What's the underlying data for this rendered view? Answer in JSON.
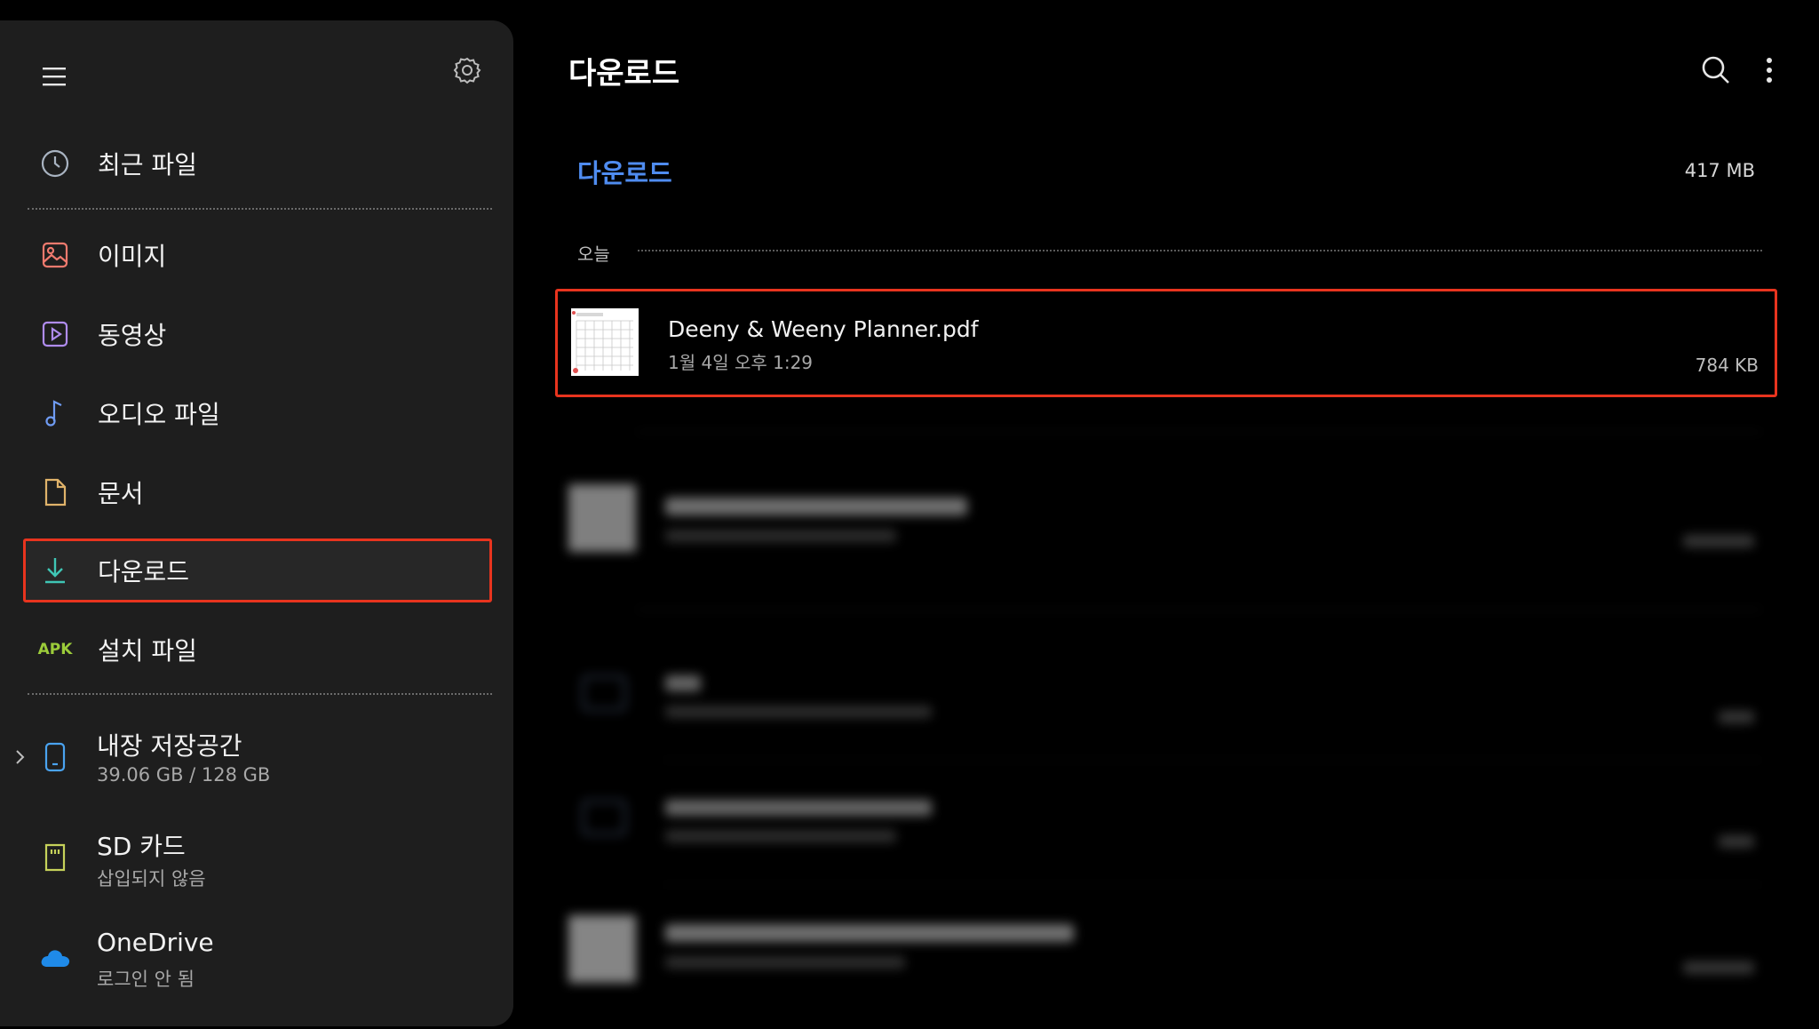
{
  "sidebar": {
    "items": [
      {
        "label": "최근 파일",
        "icon": "clock-icon"
      },
      {
        "label": "이미지",
        "icon": "image-icon"
      },
      {
        "label": "동영상",
        "icon": "video-icon"
      },
      {
        "label": "오디오 파일",
        "icon": "music-note-icon"
      },
      {
        "label": "문서",
        "icon": "document-icon"
      },
      {
        "label": "다운로드",
        "icon": "download-icon",
        "selected": true
      },
      {
        "label": "설치 파일",
        "icon": "apk-icon",
        "badge": "APK"
      }
    ],
    "storage": [
      {
        "title": "내장 저장공간",
        "subtitle": "39.06 GB / 128 GB",
        "icon": "phone-icon"
      },
      {
        "title": "SD 카드",
        "subtitle": "삽입되지 않음",
        "icon": "sd-card-icon"
      },
      {
        "title": "OneDrive",
        "subtitle": "로그인 안 됨",
        "icon": "cloud-icon"
      }
    ]
  },
  "header": {
    "title": "다운로드"
  },
  "breadcrumb": {
    "label": "다운로드",
    "total_size": "417 MB"
  },
  "sections": [
    {
      "label": "오늘",
      "files": [
        {
          "name": "Deeny & Weeny Planner.pdf",
          "date": "1월 4일 오후 1:29",
          "size": "784 KB"
        }
      ]
    }
  ],
  "colors": {
    "accent_blue": "#4f8cf0",
    "highlight_red": "#e8341e",
    "sidebar_bg": "#1e1e1e",
    "apk_green": "#9ccc3a"
  }
}
